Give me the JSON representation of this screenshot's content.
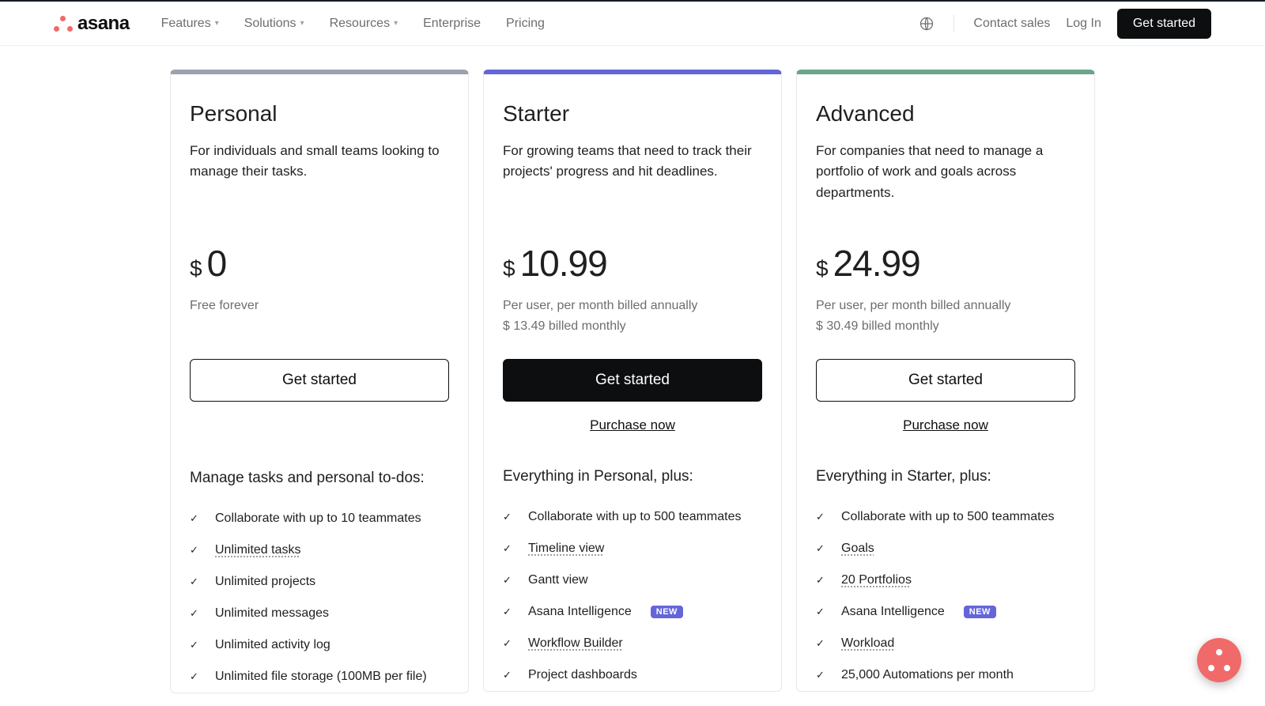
{
  "brand": {
    "name": "asana"
  },
  "nav": {
    "links": [
      "Features",
      "Solutions",
      "Resources",
      "Enterprise",
      "Pricing"
    ],
    "contact": "Contact sales",
    "login": "Log In",
    "cta": "Get started"
  },
  "tiers": {
    "personal": {
      "name": "Personal",
      "desc": "For individuals and small teams looking to manage their tasks.",
      "currency": "$",
      "amount": "0",
      "note1": "Free forever",
      "note2": "",
      "cta": "Get started",
      "feat_head": "Manage tasks and personal to-dos:",
      "features": [
        {
          "text": "Collaborate with up to 10 teammates",
          "underline": false
        },
        {
          "text": "Unlimited tasks",
          "underline": true
        },
        {
          "text": "Unlimited projects",
          "underline": false
        },
        {
          "text": "Unlimited messages",
          "underline": false
        },
        {
          "text": "Unlimited activity log",
          "underline": false
        },
        {
          "text": "Unlimited file storage (100MB per file)",
          "underline": false
        }
      ]
    },
    "starter": {
      "name": "Starter",
      "desc": "For growing teams that need to track their projects' progress and hit deadlines.",
      "currency": "$",
      "amount": "10.99",
      "note1": "Per user, per month billed annually",
      "note2": "$ 13.49 billed monthly",
      "cta": "Get started",
      "purchase": "Purchase now",
      "feat_head": "Everything in Personal, plus:",
      "features": [
        {
          "text": "Collaborate with up to 500 teammates",
          "underline": false
        },
        {
          "text": "Timeline view",
          "underline": true
        },
        {
          "text": "Gantt view",
          "underline": false
        },
        {
          "text": "Asana Intelligence",
          "underline": false,
          "badge": "NEW"
        },
        {
          "text": "Workflow Builder",
          "underline": true
        },
        {
          "text": "Project dashboards",
          "underline": false
        }
      ]
    },
    "advanced": {
      "name": "Advanced",
      "desc": "For companies that need to manage a portfolio of work and goals across departments.",
      "currency": "$",
      "amount": "24.99",
      "note1": "Per user, per month billed annually",
      "note2": "$ 30.49 billed monthly",
      "cta": "Get started",
      "purchase": "Purchase now",
      "feat_head": "Everything in Starter, plus:",
      "features": [
        {
          "text": "Collaborate with up to 500 teammates",
          "underline": false
        },
        {
          "text": "Goals",
          "underline": true
        },
        {
          "text": "20 Portfolios",
          "underline": true
        },
        {
          "text": "Asana Intelligence",
          "underline": false,
          "badge": "NEW"
        },
        {
          "text": "Workload",
          "underline": true
        },
        {
          "text": "25,000 Automations per month",
          "underline": false
        }
      ]
    }
  }
}
